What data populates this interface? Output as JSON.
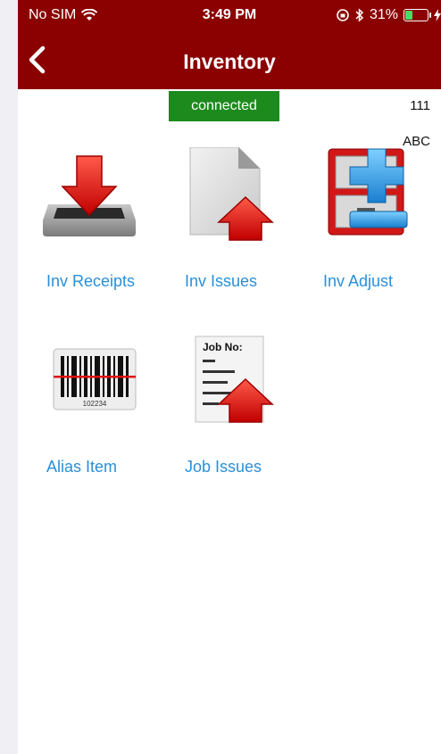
{
  "status_bar": {
    "carrier": "No SIM",
    "time": "3:49 PM",
    "battery": "31%"
  },
  "nav": {
    "title": "Inventory",
    "back_icon": "chevron-left-icon"
  },
  "connection": {
    "status": "connected",
    "color": "#1d8a1d"
  },
  "meta": {
    "number": "111",
    "code": "ABC"
  },
  "tiles": [
    {
      "label": "Inv Receipts",
      "icon": "inbox-download-icon"
    },
    {
      "label": "Inv Issues",
      "icon": "document-upload-icon"
    },
    {
      "label": "Inv Adjust",
      "icon": "cabinet-adjust-icon"
    },
    {
      "label": "Alias Item",
      "icon": "barcode-icon"
    },
    {
      "label": "Job Issues",
      "icon": "job-document-icon"
    }
  ],
  "job_icon_text": "Job No:",
  "barcode_number": "102234",
  "colors": {
    "header": "#8b0000",
    "link": "#2a8fd8"
  }
}
